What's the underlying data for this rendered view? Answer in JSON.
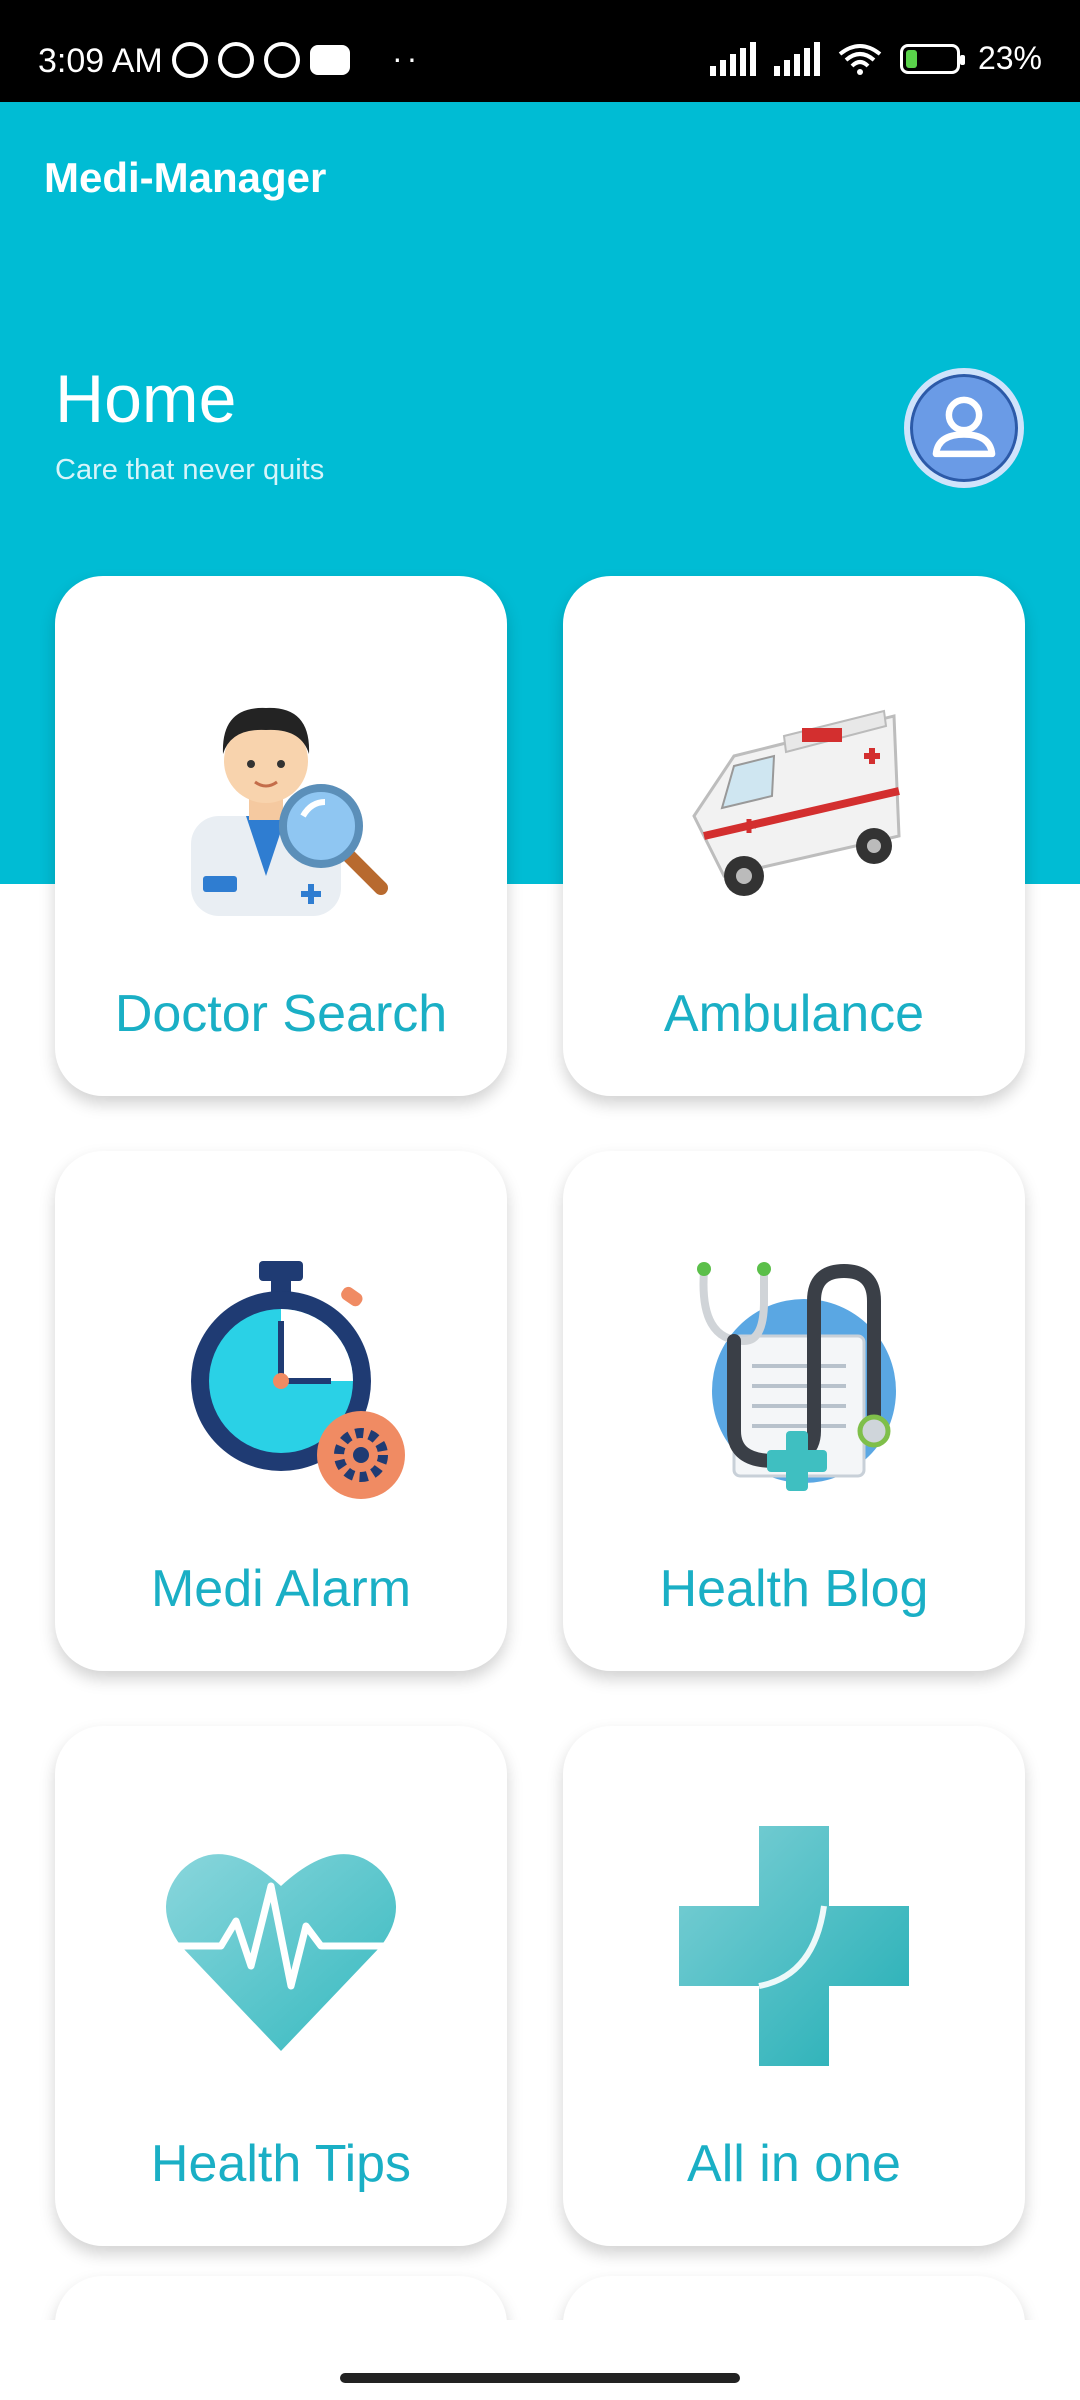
{
  "status_bar": {
    "time": "3:09 AM",
    "dots": "··",
    "battery_percent": "23%",
    "battery_level": 0.23,
    "icons": [
      "alarm-icon",
      "messenger-icon",
      "app-icon",
      "youtube-icon",
      "signal-icon",
      "signal-icon",
      "wifi-icon",
      "battery-charging-icon"
    ]
  },
  "app_bar": {
    "title": "Medi-Manager"
  },
  "header": {
    "title": "Home",
    "subtitle": "Care that never quits",
    "avatar_icon": "user-avatar-icon"
  },
  "cards": [
    {
      "label": "Doctor Search",
      "icon": "doctor-search-icon"
    },
    {
      "label": "Ambulance",
      "icon": "ambulance-icon"
    },
    {
      "label": "Medi Alarm",
      "icon": "stopwatch-alarm-icon"
    },
    {
      "label": "Health Blog",
      "icon": "stethoscope-blog-icon"
    },
    {
      "label": "Health Tips",
      "icon": "heartbeat-icon"
    },
    {
      "label": "All in one",
      "icon": "medical-cross-icon"
    }
  ],
  "colors": {
    "primary": "#00BCD4",
    "label": "#1AAFC5",
    "status_bar": "#000000"
  }
}
